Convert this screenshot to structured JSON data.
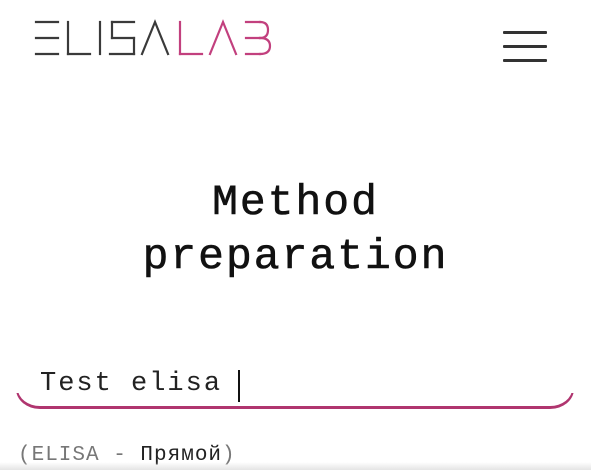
{
  "header": {
    "logo": {
      "text": "ELISALAB",
      "part_dark": "ELISA",
      "part_accent": "LAB",
      "dark_color": "#3a3a3a",
      "accent_color": "#c2407e"
    },
    "menu_icon": "hamburger-menu-icon"
  },
  "main": {
    "title_line1": "Method",
    "title_line2": "preparation"
  },
  "search": {
    "value": "Test elisa",
    "accent_color": "#b0356f"
  },
  "results": {
    "items": [
      {
        "open": "(ELISA - ",
        "highlight": "Прямой",
        "close": ")"
      }
    ]
  }
}
